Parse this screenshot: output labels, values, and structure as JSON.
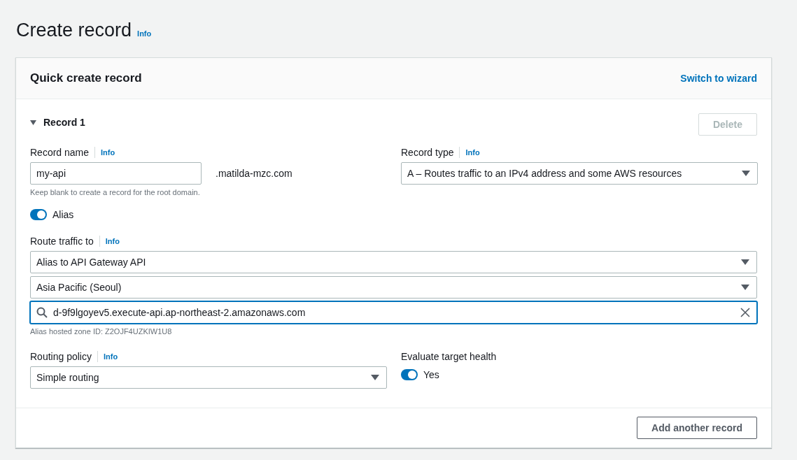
{
  "page": {
    "title": "Create record",
    "info": "Info"
  },
  "card": {
    "title": "Quick create record",
    "switch_link": "Switch to wizard"
  },
  "record": {
    "title": "Record 1",
    "expanded": true,
    "delete_button": {
      "label": "Delete",
      "disabled": true
    },
    "record_name": {
      "label": "Record name",
      "info": "Info",
      "value": "my-api",
      "suffix": ".matilda-mzc.com",
      "hint": "Keep blank to create a record for the root domain."
    },
    "record_type": {
      "label": "Record type",
      "info": "Info",
      "value": "A – Routes traffic to an IPv4 address and some AWS resources"
    },
    "alias": {
      "label": "Alias",
      "on": true
    },
    "route_traffic_to": {
      "label": "Route traffic to",
      "info": "Info",
      "endpoint": "Alias to API Gateway API",
      "region": "Asia Pacific (Seoul)",
      "target": "d-9f9lgoyev5.execute-api.ap-northeast-2.amazonaws.com",
      "hint": "Alias hosted zone ID: Z2OJF4UZKIW1U8"
    },
    "routing_policy": {
      "label": "Routing policy",
      "info": "Info",
      "value": "Simple routing"
    },
    "evaluate_target_health": {
      "label": "Evaluate target health",
      "value_label": "Yes",
      "on": true
    }
  },
  "add_button": "Add another record"
}
